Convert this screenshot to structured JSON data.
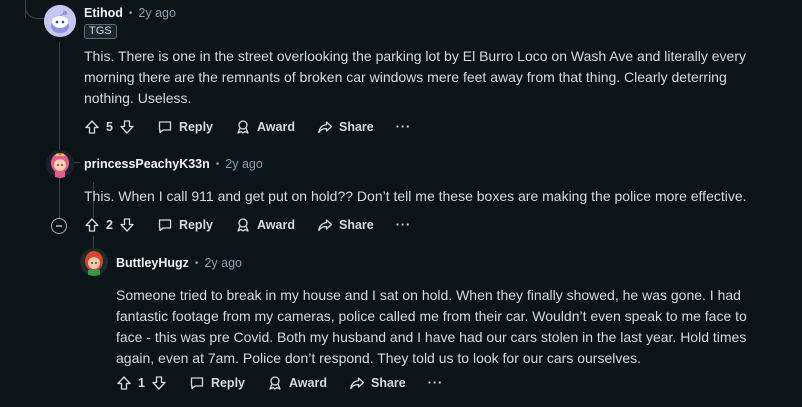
{
  "comments": [
    {
      "username": "Etihod",
      "separator": "•",
      "time": "2y ago",
      "flair": "TGS",
      "body": "This. There is one in the street overlooking the parking lot by El Burro Loco on Wash Ave and literally every morning there are the remnants of broken car windows mere feet away from that thing. Clearly deterring nothing. Useless.",
      "votes": "5",
      "reply_label": "Reply",
      "award_label": "Award",
      "share_label": "Share",
      "more_label": "···"
    },
    {
      "username": "princessPeachyK33n",
      "separator": "•",
      "time": "2y ago",
      "body": "This. When I call 911 and get put on hold?? Don’t tell me these boxes are making the police more effective.",
      "votes": "2",
      "reply_label": "Reply",
      "award_label": "Award",
      "share_label": "Share",
      "more_label": "···"
    },
    {
      "username": "ButtleyHugz",
      "separator": "•",
      "time": "2y ago",
      "body": "Someone tried to break in my house and I sat on hold. When they finally showed, he was gone. I had fantastic footage from my cameras, police called me from their car. Wouldn’t even speak to me face to face - this was pre Covid. Both my husband and I have had our cars stolen in the last year. Hold times again, even at 7am. Police don’t respond. They told us to look for our cars ourselves.",
      "votes": "1",
      "reply_label": "Reply",
      "award_label": "Award",
      "share_label": "Share",
      "more_label": "···"
    }
  ],
  "colors": {
    "background": "#0b1416",
    "text": "#d7dadc",
    "muted": "#8ba2ad",
    "thread_line": "#3a4446"
  }
}
